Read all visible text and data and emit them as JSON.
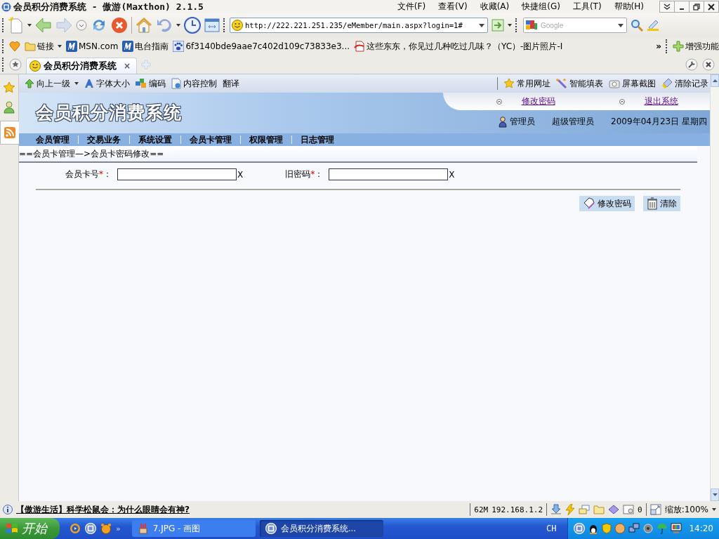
{
  "window": {
    "title": "会员积分消费系统 - 傲游(Maxthon) 2.1.5"
  },
  "menu": [
    "文件(F)",
    "查看(V)",
    "收藏(A)",
    "快捷组(G)",
    "工具(T)",
    "帮助(H)"
  ],
  "address": {
    "value": "http://222.221.251.235/eMember/main.aspx?login=1#"
  },
  "search": {
    "placeholder": "Google"
  },
  "links": [
    {
      "label": "链接",
      "kind": "folder"
    },
    {
      "label": "MSN.com",
      "kind": "msn"
    },
    {
      "label": "电台指南",
      "kind": "msn"
    },
    {
      "label": "6f3140bde9aae7c402d109c73833e3...",
      "kind": "paw"
    },
    {
      "label": "这些东东，你见过几种吃过几味？（YC）-图片照片-Ⅰ",
      "kind": "page"
    }
  ],
  "links_more": "»",
  "enhance": "增强功能",
  "tabs": [
    {
      "label": "会员积分消费系统",
      "close": "×",
      "selected": true
    }
  ],
  "page_toolbar": {
    "left": [
      {
        "label": "向上一级",
        "kind": "up"
      },
      {
        "label": "字体大小",
        "kind": "font"
      },
      {
        "label": "编码",
        "kind": "encoding"
      },
      {
        "label": "内容控制",
        "kind": "content"
      },
      {
        "label": "翻译",
        "kind": "none"
      }
    ],
    "right": [
      {
        "label": "常用网址",
        "kind": "star"
      },
      {
        "label": "智能填表",
        "kind": "wand"
      },
      {
        "label": "屏幕截图",
        "kind": "camera"
      },
      {
        "label": "清除记录",
        "kind": "eraser"
      }
    ]
  },
  "header": {
    "logo": "会员积分消费系统",
    "links": [
      "修改密码",
      "退出系统"
    ],
    "role": "管理员",
    "user": "超级管理员",
    "date": "2009年04月23日 星期四"
  },
  "nav": [
    "会员管理",
    "交易业务",
    "系统设置",
    "会员卡管理",
    "权限管理",
    "日志管理"
  ],
  "breadcrumb": "==会员卡管理—>会员卡密码修改==",
  "fields": [
    {
      "label": "会员卡号",
      "required_mark": "*",
      "colon": "：",
      "clear": "X"
    },
    {
      "label": "旧密码",
      "required_mark": "*",
      "colon": "：",
      "clear": "X"
    }
  ],
  "buttons": [
    {
      "label": "修改密码",
      "kind": "edit"
    },
    {
      "label": "清除",
      "kind": "trash"
    }
  ],
  "status_bar": {
    "news": "【傲游生活】科学松鼠会：为什么眼睛会有神?",
    "memory": "62M",
    "ip": "192.168.1.2",
    "popups": "0",
    "zoom": "缩放:100%"
  },
  "taskbar": {
    "start": "开始",
    "more": "»",
    "tasks": [
      {
        "label": "7.JPG - 画图",
        "kind": "paint",
        "selected": false
      },
      {
        "label": "会员积分消费系统...",
        "kind": "browser",
        "selected": true
      }
    ],
    "lang": "CH",
    "clock": "14:20"
  }
}
